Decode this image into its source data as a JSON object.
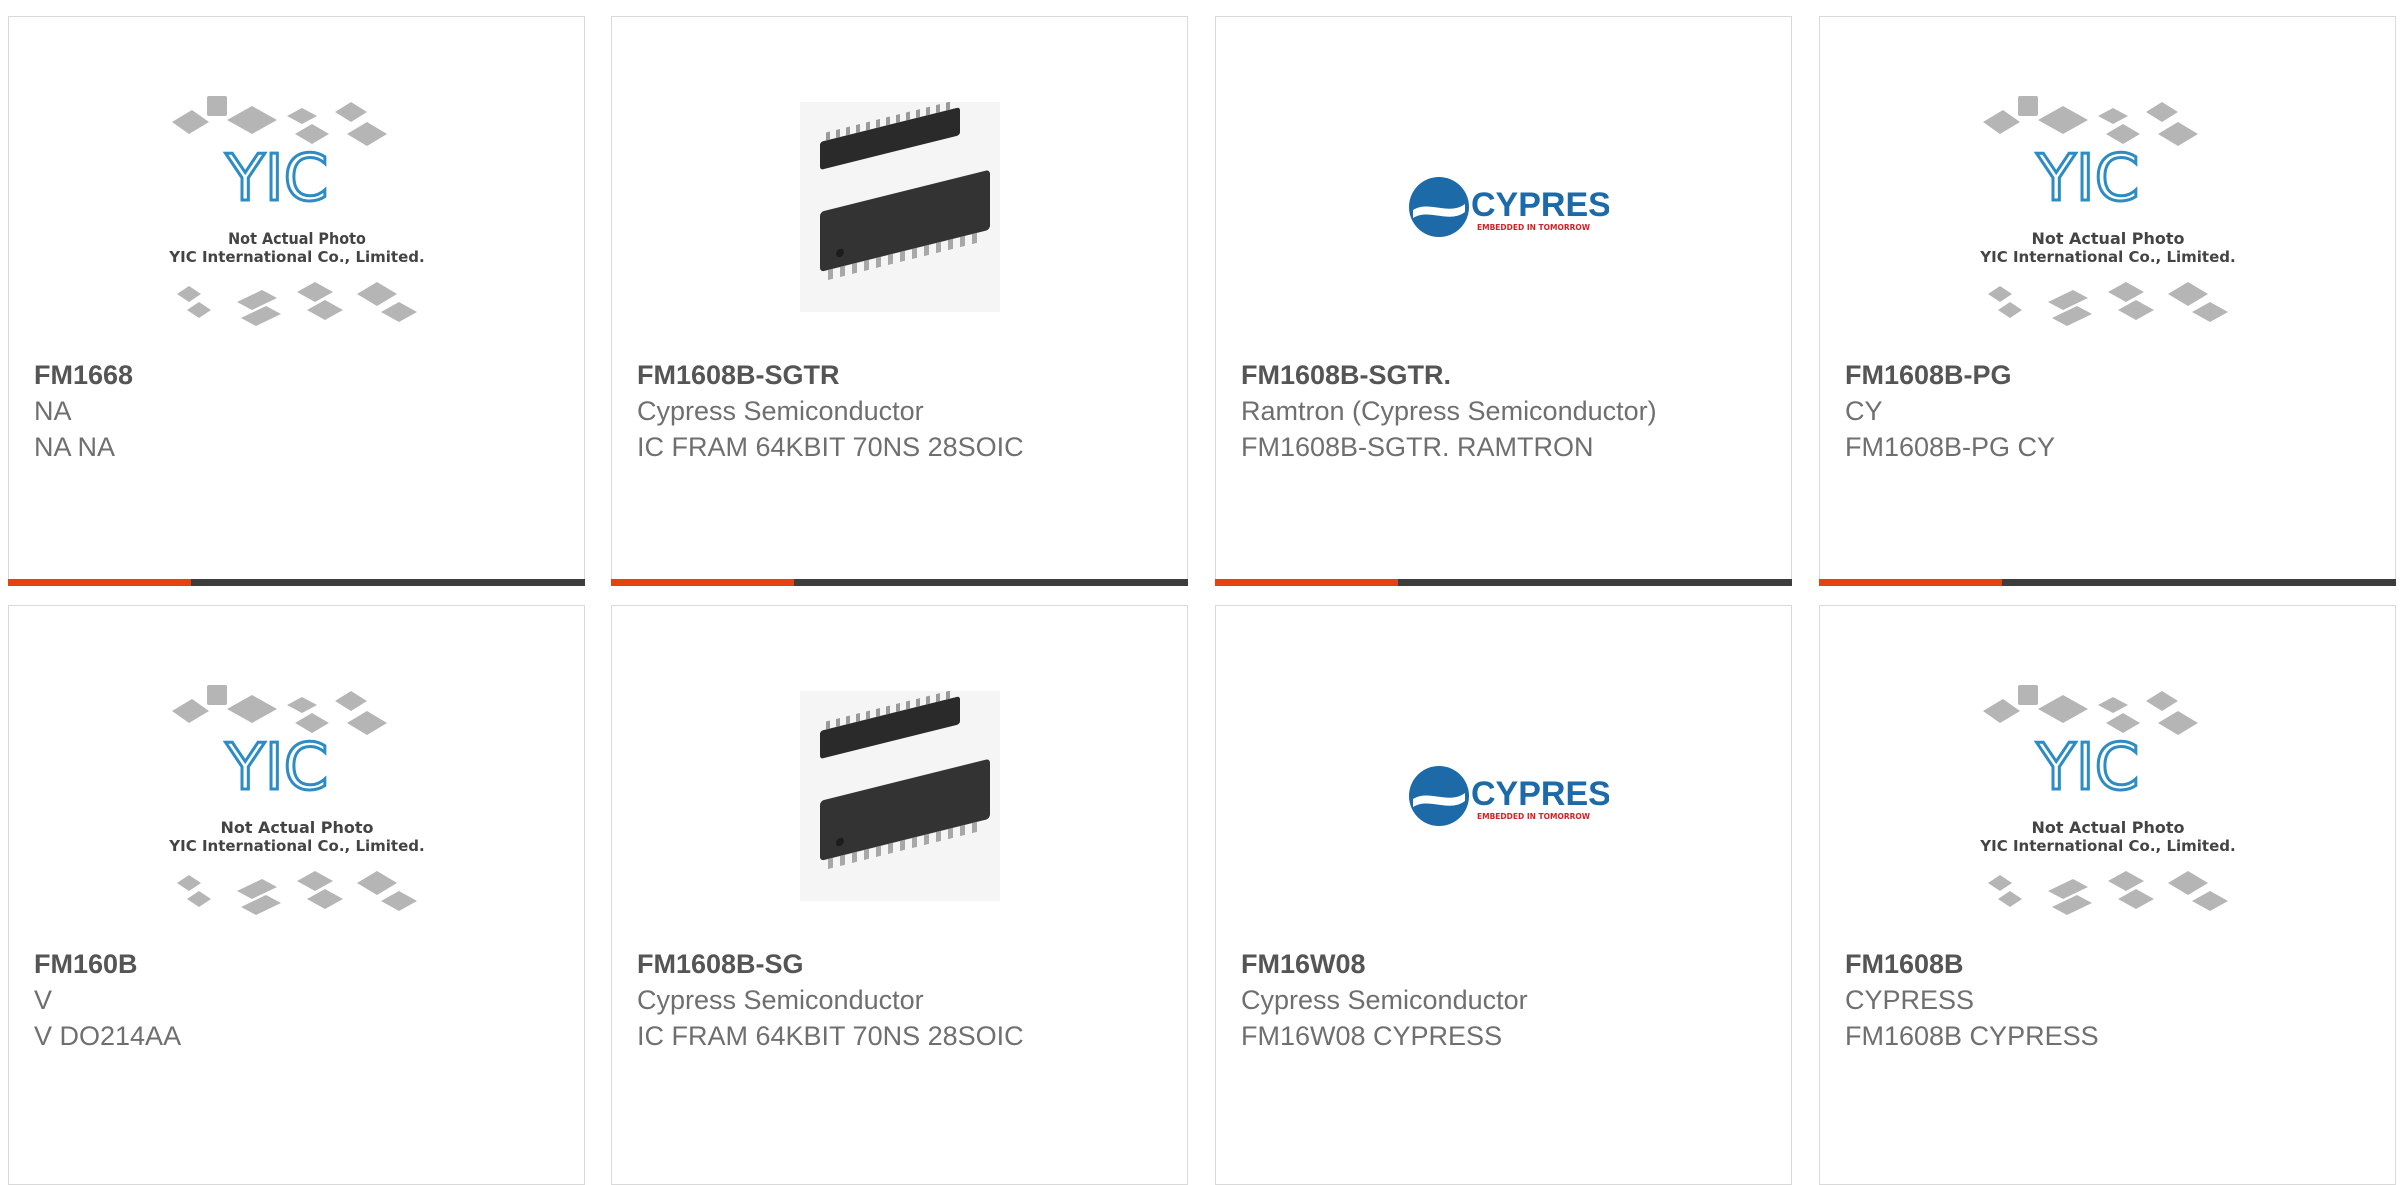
{
  "placeholder_image": {
    "line1": "Not Actual Photo",
    "line2": "YIC International Co., Limited.",
    "logo_text": "YIC"
  },
  "cypress_logo": {
    "brand": "CYPRESS",
    "tagline": "EMBEDDED IN TOMORROW"
  },
  "colors": {
    "accent": "#e4420f",
    "dark_bar": "#3d3d3d",
    "yic_blue": "#2d8cc4",
    "cypress_blue": "#1c6aa8",
    "cypress_red": "#d81f26"
  },
  "products": [
    {
      "part_number": "FM1668",
      "manufacturer": "NA",
      "description": "NA NA",
      "image": "placeholder"
    },
    {
      "part_number": "FM1608B-SGTR",
      "manufacturer": "Cypress Semiconductor",
      "description": "IC FRAM 64KBIT 70NS 28SOIC",
      "image": "soic"
    },
    {
      "part_number": "FM1608B-SGTR.",
      "manufacturer": "Ramtron (Cypress Semiconductor)",
      "description": "FM1608B-SGTR. RAMTRON",
      "image": "cypress"
    },
    {
      "part_number": "FM1608B-PG",
      "manufacturer": "CY",
      "description": "FM1608B-PG CY",
      "image": "placeholder"
    },
    {
      "part_number": "FM160B",
      "manufacturer": "V",
      "description": "V DO214AA",
      "image": "placeholder"
    },
    {
      "part_number": "FM1608B-SG",
      "manufacturer": "Cypress Semiconductor",
      "description": "IC FRAM 64KBIT 70NS 28SOIC",
      "image": "soic"
    },
    {
      "part_number": "FM16W08",
      "manufacturer": "Cypress Semiconductor",
      "description": "FM16W08 CYPRESS",
      "image": "cypress"
    },
    {
      "part_number": "FM1608B",
      "manufacturer": "CYPRESS",
      "description": "FM1608B CYPRESS",
      "image": "placeholder"
    }
  ]
}
